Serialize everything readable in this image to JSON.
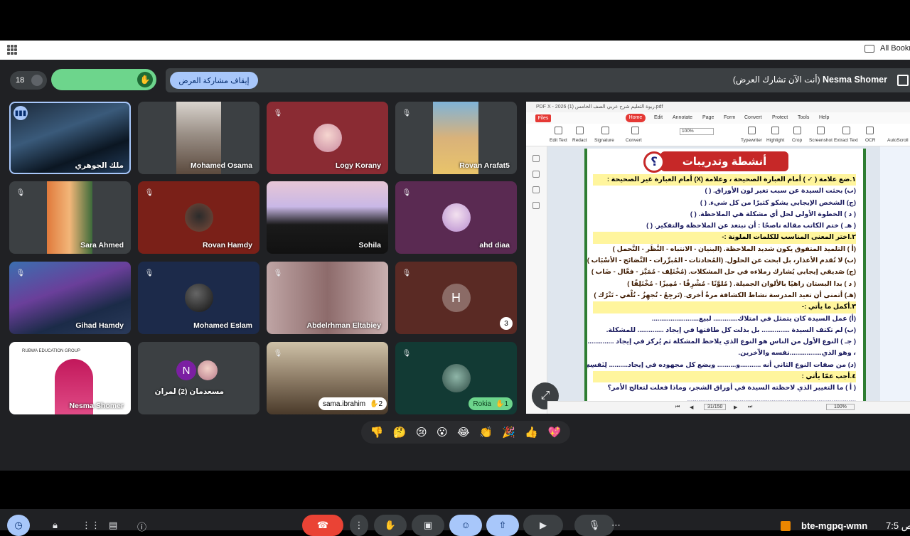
{
  "browser": {
    "bookmarks_label": "All Bookm"
  },
  "meet": {
    "participants_count": "18",
    "present_bar": {
      "stop_button": "إيقاف مشاركة العرض",
      "presenter_name": "Nesma Shomer",
      "presenting_note": "(أنت الآن تشارك العرض)"
    },
    "tiles": [
      {
        "name": "ملك الجوهري"
      },
      {
        "name": "Mohamed Osama"
      },
      {
        "name": "Logy Korany"
      },
      {
        "name": "Rovan Arafat5"
      },
      {
        "name": "Sara Ahmed"
      },
      {
        "name": "Rovan Hamdy"
      },
      {
        "name": "Sohila"
      },
      {
        "name": "ahd diaa"
      },
      {
        "name": "Gihad Hamdy"
      },
      {
        "name": "Mohamed Eslam"
      },
      {
        "name": "Abdelrhman Eltabiey"
      },
      {
        "name": "",
        "initial": "H",
        "hand_count": "3"
      },
      {
        "name": "Nesma Shomer",
        "logo_text": "RUBWA EDUCATION GROUP"
      },
      {
        "name": "مسعدمان (2) لمران",
        "initial": "N"
      },
      {
        "name": "sama.ibrahim",
        "hand_count": "2"
      },
      {
        "name": "Rokia",
        "hand_count": "1"
      }
    ],
    "reactions": [
      "👎",
      "🤔",
      "😢",
      "😮",
      "😂",
      "👏",
      "🎉",
      "👍",
      "💖"
    ],
    "meeting_code": "bte-mgpq-wmn",
    "clock": "7:5 ص"
  },
  "pdf": {
    "title": "PDF X - 2026  ربوة التعليم شرح عربي الصف الخامس (1).pdf",
    "files_button": "Files",
    "menu": [
      "Home",
      "Edit",
      "Annotate",
      "Page",
      "Form",
      "Convert",
      "Protect",
      "Tools",
      "Help"
    ],
    "tools": [
      "Edit Text",
      "Redact",
      "Signature",
      "Convert",
      "100%",
      "Typewriter",
      "Highlight",
      "Crop",
      "Screenshot",
      "Extract Text",
      "OCR",
      "AutoScroll"
    ],
    "heading": "أنشطة وتدريبات",
    "lines": [
      {
        "t": "١.ضع علامة ( ✓ ) أمام العبارة الصحيحة ، وعلامة (X) أمام العبارة غير الصحيحة :",
        "c": "sec"
      },
      {
        "t": "(ب) بحثت السيدة عن سبب تغير لون الأوراق. (  )",
        "c": ""
      },
      {
        "t": "(ج) الشخص الإيجابي يشكو كثيرًا من كل شيء. (  )",
        "c": ""
      },
      {
        "t": "( د ) الخطوة الأولى لحل أي مشكلة هي الملاحظة. (  )",
        "c": ""
      },
      {
        "t": "( هـ ) ختم الكاتب مقاله ناصحًا : أن نبتعد عن الملاحظة والتفكير. (  )",
        "c": ""
      },
      {
        "t": "٢.اختر المعنى المناسب للكلمات الملونة :-",
        "c": "sec"
      },
      {
        "t": "(أ ) التلميذ المتفوق يكون شديد الملاحظة. (البنيان - الانتباه - النَّظَر - التَّحمل )",
        "c": "q"
      },
      {
        "t": "(ب) لا تُقدم الأعذار، بل ابحث عن الحلول. (المُحادثات - المُبرِّرات - النَّصَائح - الأسْبَاب )",
        "c": "q"
      },
      {
        "t": "(ج) صَديقي إيجابي يُشارك زملاءه في حل المشكلات. (مُخْتَلِف - مُمَيَّز - فعَّال - ضَاب )",
        "c": "q"
      },
      {
        "t": "( د ) بدا البستان زاهيًا بالألوان الجميلة. ( مُلوَّنًا - مُشْرِقًا - مُمِيزًا - مُخْتَلِفًا )",
        "c": "q"
      },
      {
        "t": "(هـ) أتمنى أن تعيد المدرسة نشاط الكشافة مرةً أخرى. (تَرجِعُ - تُجهِزُ - تُلْغي - تَتْرُك )",
        "c": "q"
      },
      {
        "t": "٣.أكمل ما يأتي :-",
        "c": "sec"
      },
      {
        "t": "(أ) عمل السيدة كان يتمثل في امتلاك............. لبيع.........................",
        "c": ""
      },
      {
        "t": "(ب) لم تكتف السيدة ............... بل بذلت كل طاقتها في إيجاد .............. للمشكلة.",
        "c": ""
      },
      {
        "t": "( جـ ) النوع الأول من الناس هو النوع الذي يلاحظ المشكلة ثم يُركز في إيجاد ..............",
        "c": ""
      },
      {
        "t": "، وهو الذي.................نفسه والآخرين.",
        "c": ""
      },
      {
        "t": "(د) من صفات النوع الثاني أنه ...........و.......... ويضع كل مجهوده في إيجاد.......... لِنَفسِهِ",
        "c": ""
      },
      {
        "t": "٤.أجب عمّا يأتي :",
        "c": "sec"
      },
      {
        "t": "( أ ) ما التغيير الذي لاحظته السيدة في أوراق الشجر، وماذا فعلت لتعالج الأمر؟",
        "c": ""
      },
      {
        "t": "..........................................................................................",
        "c": ""
      }
    ],
    "page_indicator": "31/150",
    "zoom": "100%"
  }
}
